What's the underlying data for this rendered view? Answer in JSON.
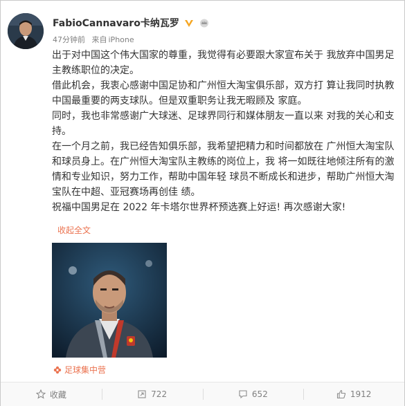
{
  "post": {
    "user_name": "FabioCannavaro卡纳瓦罗",
    "time": "47分钟前",
    "source_prefix": "来自",
    "device": "iPhone",
    "paragraphs": [
      "出于对中国这个伟大国家的尊重，我觉得有必要跟大家宣布关于 我放弃中国男足主教练职位的决定。",
      "借此机会，我衷心感谢中国足协和广州恒大淘宝俱乐部，双方打 算让我同时执教中国最重要的两支球队。但是双重职务让我无暇顾及 家庭。",
      "同时，我也非常感谢广大球迷、足球界同行和媒体朋友一直以来 对我的关心和支持。",
      "在一个月之前，我已经告知俱乐部，我希望把精力和时间都放在 广州恒大淘宝队和球员身上。在广州恒大淘宝队主教练的岗位上，我 将一如既往地倾注所有的激情和专业知识，努力工作，帮助中国年轻 球员不断成长和进步，帮助广州恒大淘宝队在中超、亚冠赛场再创佳 绩。",
      "祝福中国男足在 2022 年卡塔尔世界杯预选赛上好运! 再次感谢大家!"
    ],
    "collapse_label": "收起全文",
    "media_source": "足球集中营"
  },
  "actions": {
    "favorite_label": "收藏",
    "repost_count": "722",
    "comment_count": "652",
    "like_count": "1912"
  },
  "colors": {
    "link": "#eb7350",
    "verified": "#f5a623",
    "meta": "#808080"
  },
  "icons": {
    "verified": "verified-badge-icon",
    "vip": "vip-crown-icon",
    "favorite": "star-icon",
    "repost": "repost-icon",
    "comment": "comment-icon",
    "like": "thumbs-up-icon",
    "source": "flower-icon"
  }
}
